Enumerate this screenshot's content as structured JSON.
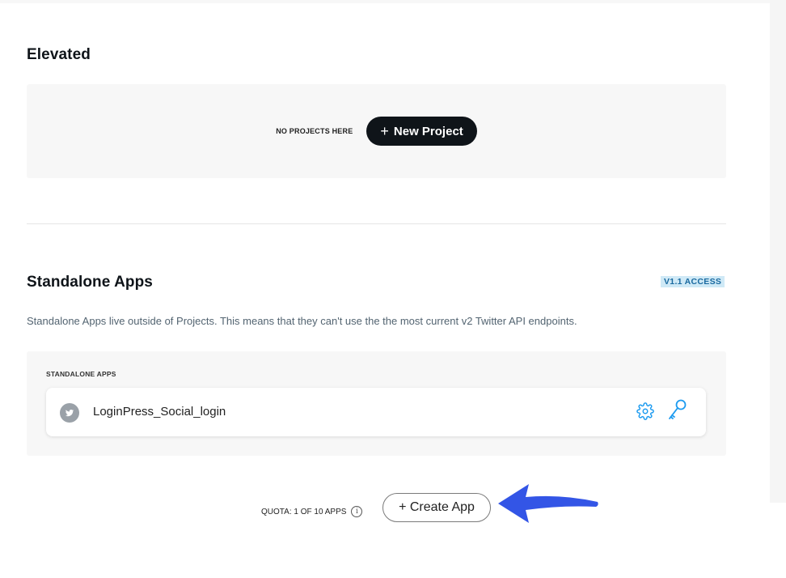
{
  "elevated": {
    "title": "Elevated",
    "empty_label": "NO PROJECTS HERE",
    "new_project_label": "New Project"
  },
  "standalone": {
    "title": "Standalone Apps",
    "badge": "V1.1 ACCESS",
    "description": "Standalone Apps live outside of Projects. This means that they can't use the the most current v2 Twitter API endpoints.",
    "panel_label": "STANDALONE APPS",
    "apps": [
      {
        "name": "LoginPress_Social_login",
        "icon": "twitter-bird-icon"
      }
    ],
    "actions": [
      "gear-icon",
      "key-icon"
    ]
  },
  "footer": {
    "quota": "QUOTA: 1 OF 10 APPS",
    "info_icon": "i",
    "create_app_label": "+ Create App"
  },
  "colors": {
    "primary_button": "#0f1419",
    "link_blue": "#1d9bf0",
    "badge_bg": "#cfe9f6",
    "annotation_arrow": "#3355e6"
  }
}
